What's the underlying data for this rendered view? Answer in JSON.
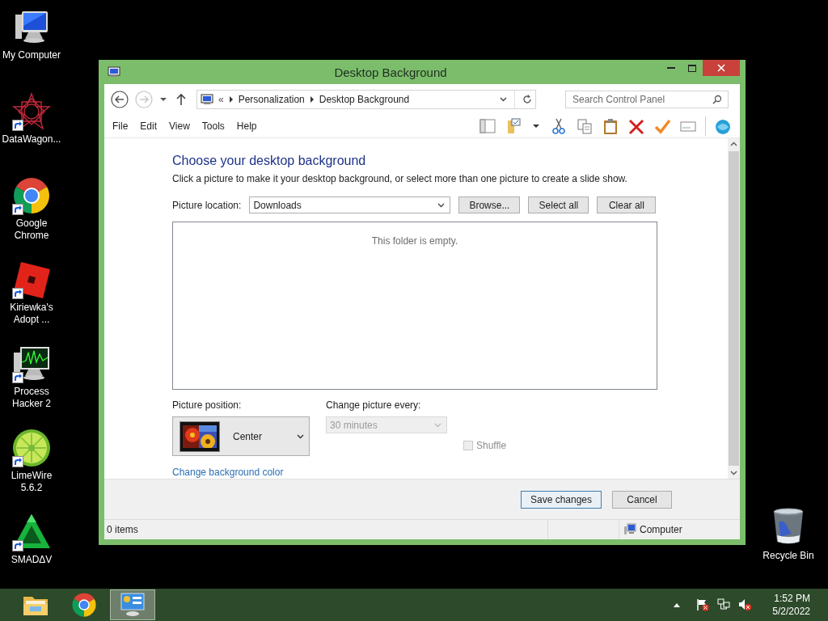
{
  "desktop_icons": [
    {
      "label": "My Computer",
      "kind": "computer",
      "shortcut": false
    },
    {
      "label": "DataWagon...",
      "kind": "star",
      "shortcut": true
    },
    {
      "label": "Google Chrome",
      "kind": "chrome",
      "shortcut": true
    },
    {
      "label": "Kiriewka's Adopt ...",
      "kind": "roblox",
      "shortcut": true
    },
    {
      "label": "Process Hacker 2",
      "kind": "monitor-graph",
      "shortcut": true
    },
    {
      "label": "LimeWire 5.6.2",
      "kind": "lime",
      "shortcut": true
    },
    {
      "label": "SMADΔV",
      "kind": "triangle",
      "shortcut": true
    }
  ],
  "recycle_bin": {
    "label": "Recycle Bin"
  },
  "window": {
    "title": "Desktop Background",
    "nav": {
      "back_disabled": false,
      "forward_disabled": true
    },
    "address": {
      "prefix": "«",
      "path": [
        "Personalization",
        "Desktop Background"
      ]
    },
    "search": {
      "placeholder": "Search Control Panel"
    },
    "menu": [
      "File",
      "Edit",
      "View",
      "Tools",
      "Help"
    ],
    "heading": "Choose your desktop background",
    "description": "Click a picture to make it your desktop background, or select more than one picture to create a slide show.",
    "picture_location": {
      "label": "Picture location:",
      "value": "Downloads"
    },
    "location_buttons": [
      "Browse...",
      "Select all",
      "Clear all"
    ],
    "empty_message": "This folder is empty.",
    "picture_position": {
      "label": "Picture position:",
      "value": "Center"
    },
    "change_picture_every": {
      "label": "Change picture every:",
      "value": "30 minutes",
      "disabled": true
    },
    "shuffle": {
      "label": "Shuffle",
      "checked": false,
      "disabled": true
    },
    "link": "Change background color",
    "buttons": [
      {
        "label": "Save changes",
        "default": true
      },
      {
        "label": "Cancel",
        "default": false
      }
    ],
    "status_bar": {
      "items": "0 items",
      "location": "Computer"
    }
  },
  "taskbar": {
    "apps": [
      {
        "kind": "folder",
        "selected": false
      },
      {
        "kind": "chrome",
        "selected": false
      },
      {
        "kind": "control-panel",
        "selected": true
      }
    ],
    "time": "1:52 PM",
    "date": "5/2/2022"
  }
}
